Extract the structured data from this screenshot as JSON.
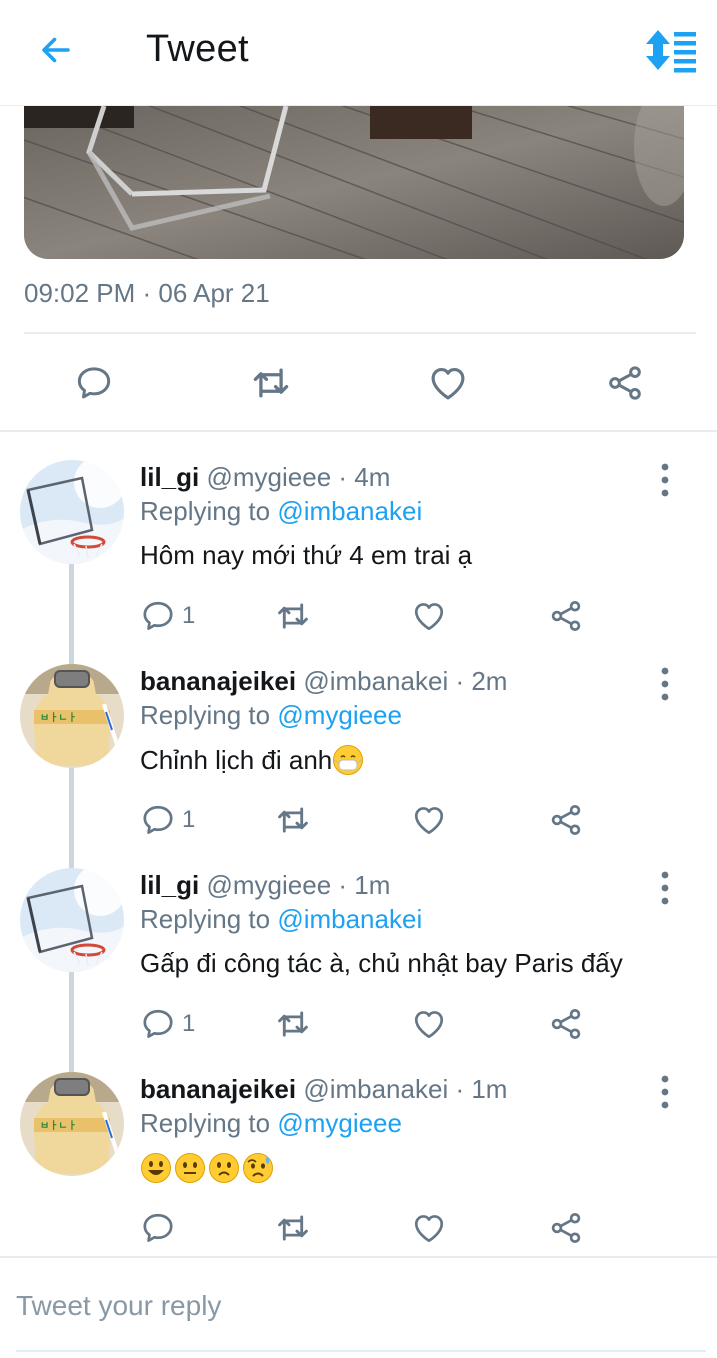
{
  "header": {
    "title": "Tweet",
    "back_icon": "arrow-left-icon",
    "sort_icon": "sort-icon"
  },
  "tweet": {
    "timestamp": "09:02 PM · 06 Apr 21"
  },
  "colors": {
    "accent": "#1da1f2",
    "muted": "#657786",
    "divider": "#e6ecf0"
  },
  "replies": [
    {
      "name": "lil_gi",
      "handle": "@mygieee · 4m",
      "replying_prefix": "Replying to",
      "replying_to": "@imbanakei",
      "text": "Hôm nay mới thứ 4 em trai ạ",
      "reply_count": "1",
      "avatar": "basketball-hoop"
    },
    {
      "name": "bananajeikei",
      "handle": "@imbanakei · 2m",
      "replying_prefix": "Replying to",
      "replying_to": "@mygieee",
      "text": "Chỉnh lịch đi anh",
      "emoji": [
        "mask-face"
      ],
      "reply_count": "1",
      "avatar": "banana-milk"
    },
    {
      "name": "lil_gi",
      "handle": "@mygieee · 1m",
      "replying_prefix": "Replying to",
      "replying_to": "@imbanakei",
      "text": "Gấp đi công tác à, chủ nhật bay Paris đấy",
      "reply_count": "1",
      "avatar": "basketball-hoop"
    },
    {
      "name": "bananajeikei",
      "handle": "@imbanakei · 1m",
      "replying_prefix": "Replying to",
      "replying_to": "@mygieee",
      "text": "",
      "emoji": [
        "smile",
        "neutral",
        "worried",
        "sad-sweat"
      ],
      "reply_count": "",
      "avatar": "banana-milk"
    }
  ],
  "reply_input": {
    "placeholder": "Tweet your reply"
  }
}
